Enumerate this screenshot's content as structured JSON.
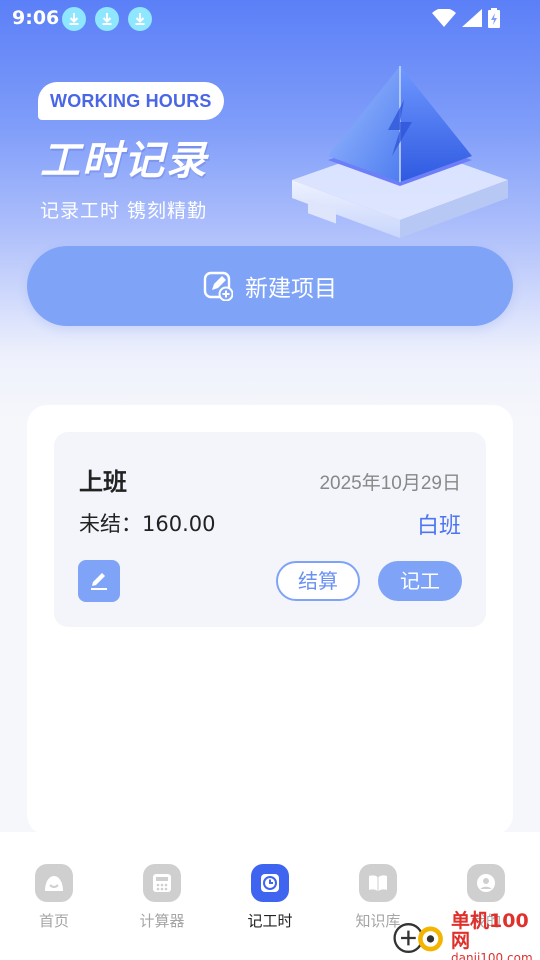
{
  "status_bar": {
    "time": "9:06"
  },
  "hero": {
    "badge": "WORKING HOURS",
    "title": "工时记录",
    "subtitle": "记录工时  镌刻精勤",
    "new_project_label": "新建项目"
  },
  "record": {
    "name": "上班",
    "date": "2025年10月29日",
    "unsettled": "未结：160.00",
    "shift": "白班",
    "settle_label": "结算",
    "log_label": "记工"
  },
  "nav": {
    "items": [
      {
        "label": "首页",
        "icon": "home-icon"
      },
      {
        "label": "计算器",
        "icon": "calculator-icon"
      },
      {
        "label": "记工时",
        "icon": "clock-icon",
        "active": true
      },
      {
        "label": "知识库",
        "icon": "book-icon"
      },
      {
        "label": "我的",
        "icon": "profile-icon"
      }
    ]
  },
  "watermark": {
    "name": "单机100网",
    "url": "danji100.com"
  },
  "colors": {
    "primary": "#3f64f0",
    "button": "#7fa4f7",
    "accent_text": "#4d74f1"
  }
}
